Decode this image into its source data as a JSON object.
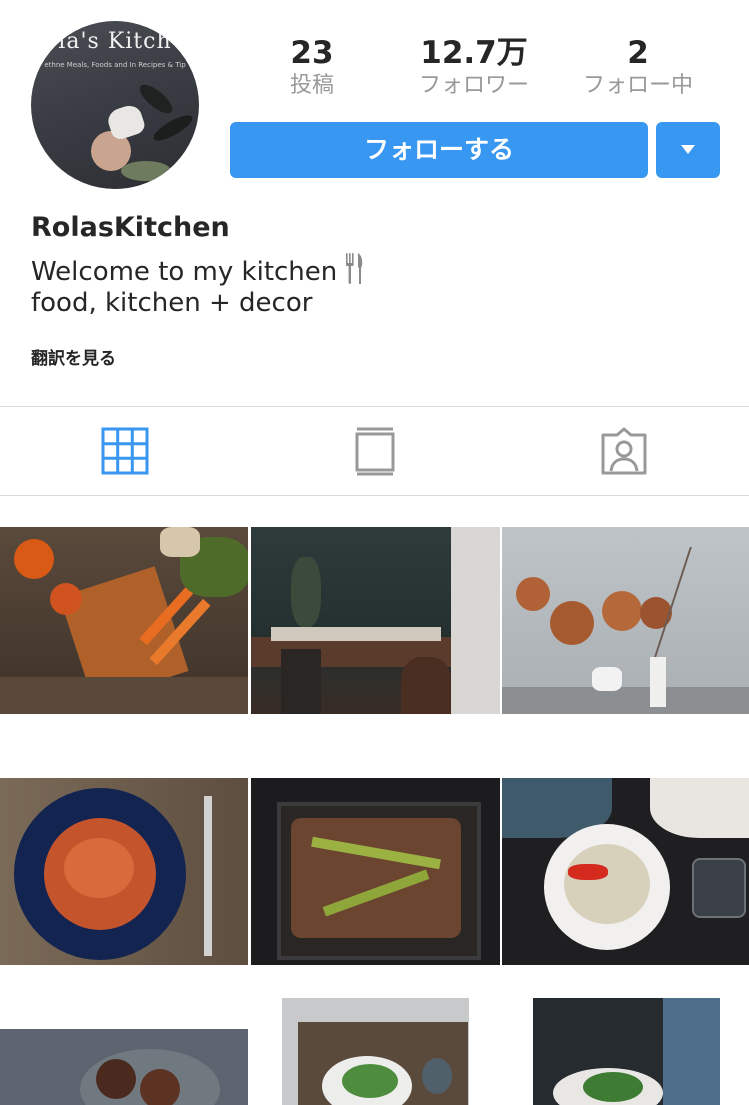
{
  "profile": {
    "avatar_text": {
      "title": "la's Kitch",
      "subtitle": "ethne Meals, Foods and In Recipes & Tip"
    },
    "stats": {
      "posts": {
        "value": "23",
        "label": "投稿"
      },
      "followers": {
        "value": "12.7万",
        "label": "フォロワー"
      },
      "following": {
        "value": "2",
        "label": "フォロー中"
      }
    },
    "follow_label": "フォローする",
    "dropdown_icon": "caret-down-icon",
    "username": "RolasKitchen",
    "bio_line1": "Welcome to my kitchen",
    "bio_line1_icon": "fork-and-knife-icon",
    "bio_line2": "food, kitchen + decor",
    "translate_label": "翻訳を見る"
  },
  "tabs": [
    {
      "icon": "grid-icon",
      "active": true
    },
    {
      "icon": "feed-icon",
      "active": false
    },
    {
      "icon": "tagged-user-icon",
      "active": false
    }
  ],
  "posts": [
    {
      "subject": "carrots and pumpkins on a wooden board"
    },
    {
      "subject": "dark dining table set"
    },
    {
      "subject": "copper pans hanging in a kitchen"
    },
    {
      "subject": "pasta on a blue plate"
    },
    {
      "subject": "roasted dish in a dark baking tray"
    },
    {
      "subject": "soup bowl with peppers"
    },
    {
      "subject": "mushrooms on a grey plate"
    },
    {
      "subject": "salad on a tray"
    },
    {
      "subject": "salad plate held by a hand"
    }
  ],
  "colors": {
    "accent": "#3897f0",
    "active_tab": "#3897f0",
    "inactive_icon": "#999999",
    "text": "#262626",
    "secondary_text": "#999999",
    "divider": "#dbdbdb"
  }
}
